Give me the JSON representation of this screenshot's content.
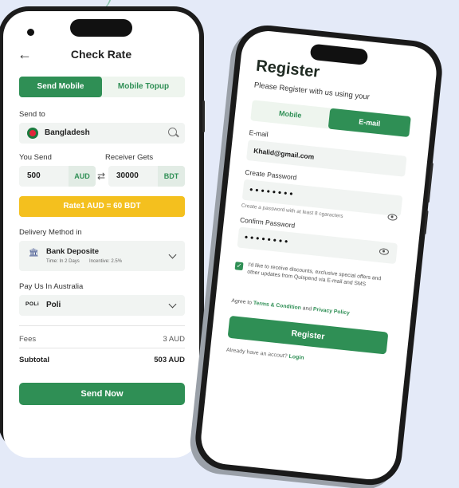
{
  "check_rate": {
    "title": "Check Rate",
    "tabs": [
      {
        "label": "Send Mobile"
      },
      {
        "label": "Mobile Topup"
      }
    ],
    "send_to_label": "Send to",
    "send_to_value": "Bangladesh",
    "you_send_label": "You Send",
    "receiver_gets_label": "Receiver Gets",
    "send_amount": "500",
    "send_currency": "AUD",
    "receive_amount": "30000",
    "receive_currency": "BDT",
    "rate_text": "Rate1 AUD = 60 BDT",
    "delivery_label": "Delivery Method in",
    "delivery_method": "Bank Deposite",
    "delivery_time": "Time: In 2 Days",
    "delivery_incentive": "Incentive: 2.5%",
    "pay_label": "Pay Us In Australia",
    "pay_logo": "POLi",
    "pay_method": "Poli",
    "fees_label": "Fees",
    "fees_value": "3 AUD",
    "subtotal_label": "Subtotal",
    "subtotal_value": "503 AUD",
    "send_button": "Send Now"
  },
  "register": {
    "title": "Register",
    "subtitle": "Please Register with us using your",
    "tabs": [
      {
        "label": "Mobile"
      },
      {
        "label": "E-mail"
      }
    ],
    "email_label": "E-mail",
    "email_value": "Khalid@gmail.com",
    "create_password_label": "Create Password",
    "password_mask": "••••••••",
    "password_hint": "Create a password with at least 8 cgaracters",
    "confirm_password_label": "Confirm Password",
    "confirm_mask": "••••••••",
    "consent_text": "I'd like to receive discounts, exclusive special offers and other updates from Quispend via E-mail and SMS",
    "agree_prefix": "Agree to ",
    "terms_link": "Terms & Condition",
    "agree_and": " and ",
    "privacy_link": "Privacy Policy",
    "register_button": "Register",
    "already_text": "Already have an accout? ",
    "login_link": "Login"
  },
  "colors": {
    "primary": "#2f8f55",
    "rate_banner": "#f4c01e",
    "background": "#e4eaf8"
  }
}
